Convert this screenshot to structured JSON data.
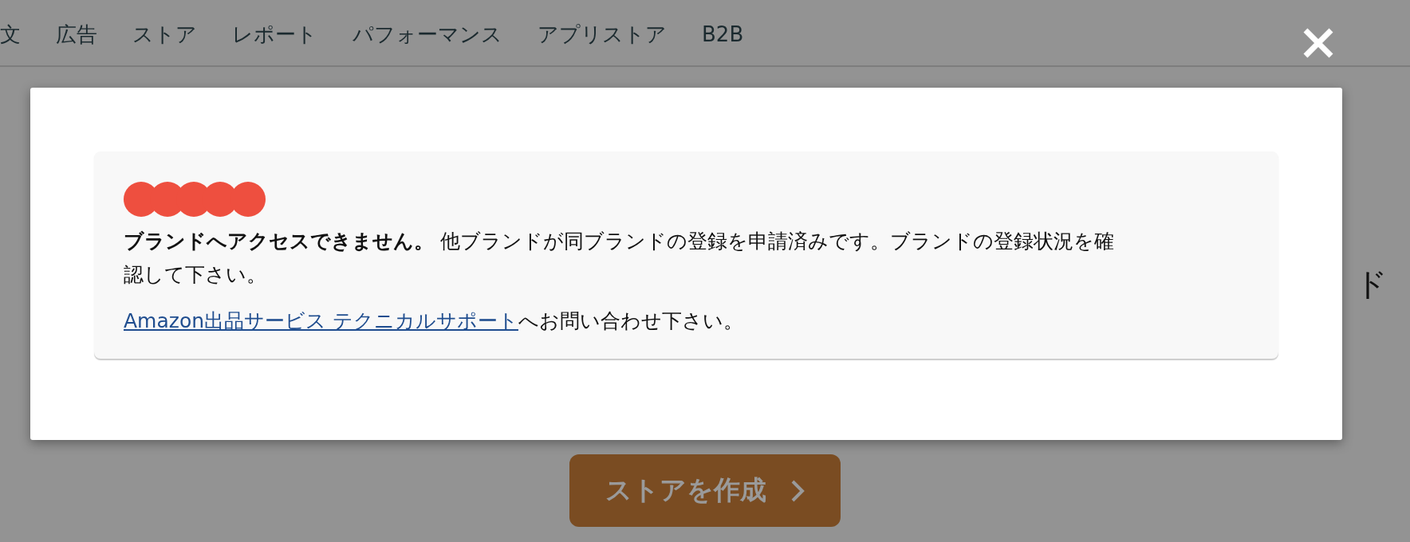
{
  "nav": {
    "items": [
      {
        "label": "文"
      },
      {
        "label": "広告"
      },
      {
        "label": "ストア"
      },
      {
        "label": "レポート"
      },
      {
        "label": "パフォーマンス"
      },
      {
        "label": "アプリストア"
      },
      {
        "label": "B2B"
      }
    ]
  },
  "background_heading": "ド",
  "create_store_button": {
    "label": "ストアを作成"
  },
  "notice": {
    "message": "**ブランドへアクセスできません。** 他ブランドが同ブランドの登録を申請済みです。ブランドの登録状況を確認して下さい。",
    "link": "Amazon出品サービス テクニカルサポート",
    "link_suffix": "へお問い合わせ下さい。"
  }
}
